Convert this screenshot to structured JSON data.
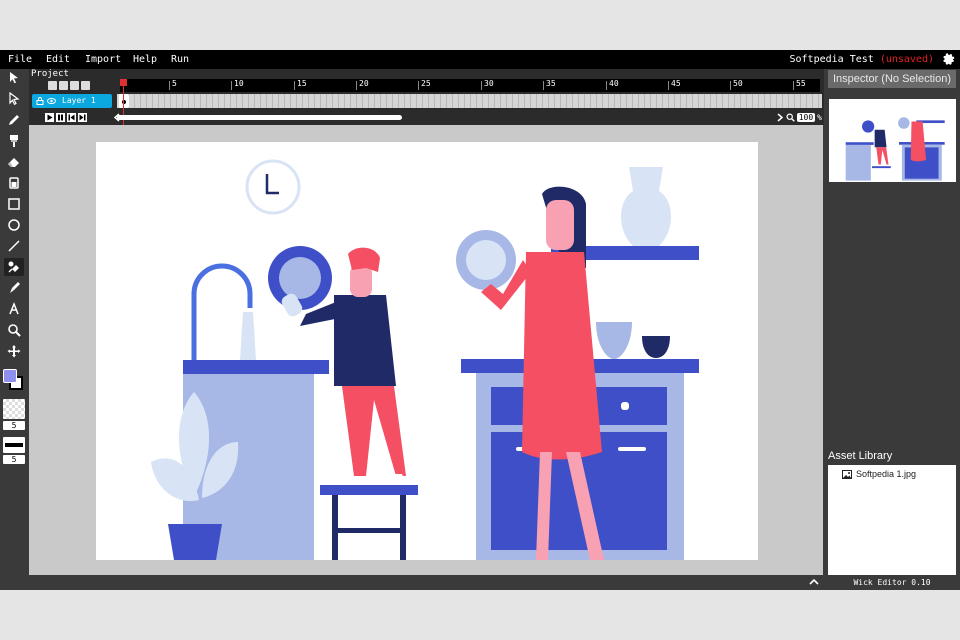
{
  "menubar": {
    "items": [
      "File",
      "Edit",
      "Import",
      "Help",
      "Run"
    ],
    "project_name": "Softpedia Test",
    "status": "(unsaved)"
  },
  "timeline": {
    "label": "Project",
    "ruler_ticks": [
      "5",
      "10",
      "15",
      "20",
      "25",
      "30",
      "35",
      "40",
      "45",
      "50",
      "55"
    ],
    "layer_name": "Layer 1",
    "zoom_value": "100",
    "zoom_unit": "%"
  },
  "toolbar": {
    "tools": [
      "cursor-icon",
      "pointer-icon",
      "pencil-icon",
      "brush-icon",
      "eraser-icon",
      "fill-bucket-icon",
      "rectangle-icon",
      "ellipse-icon",
      "line-icon",
      "eyedropper-icon",
      "pen-icon",
      "text-icon",
      "zoom-icon",
      "move-icon"
    ],
    "fill_color": "#8f8ff0",
    "stroke_color": "#000000",
    "brush_size": "5",
    "stroke_size": "5"
  },
  "inspector": {
    "title": "Inspector (No Selection)"
  },
  "assets": {
    "title": "Asset Library",
    "items": [
      "Softpedia 1.jpg"
    ]
  },
  "footer": {
    "version": "Wick Editor 0.10"
  },
  "colors": {
    "accent": "#0aa8de",
    "unsaved": "#e02020",
    "illustration_blue": "#3e4fc7",
    "illustration_red": "#f44f63",
    "illustration_navy": "#1f2a66",
    "illustration_lightblue": "#a7b7e6"
  }
}
